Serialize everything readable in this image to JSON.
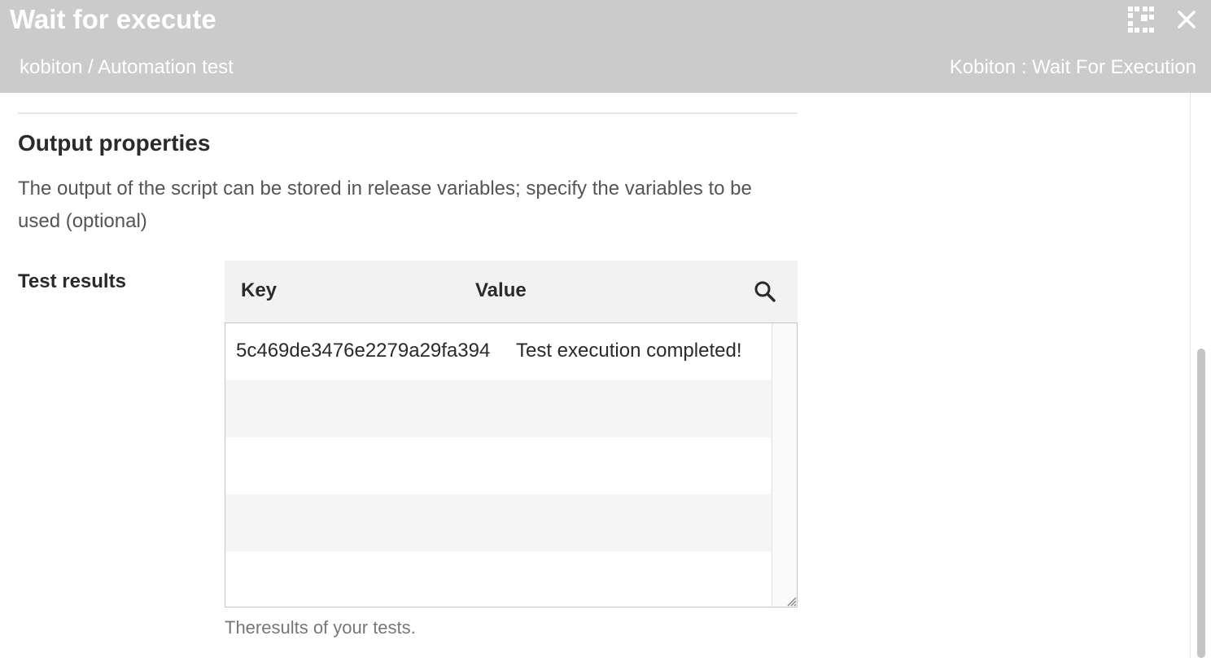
{
  "header": {
    "title": "Wait for execute",
    "breadcrumb": "kobiton / Automation test",
    "task_type": "Kobiton : Wait For Execution",
    "icons": [
      "fullscreen-exit-icon",
      "close-icon"
    ]
  },
  "output_section": {
    "title": "Output properties",
    "description": "The output of the script can be stored in release variables; specify the variables to be used (optional)"
  },
  "test_results": {
    "label": "Test results",
    "columns": {
      "key": "Key",
      "value": "Value"
    },
    "rows": [
      {
        "key": "5c469de3476e2279a29fa394",
        "value": "Test execution completed!"
      }
    ],
    "help_text": "Theresults of your tests."
  },
  "colors": {
    "header_bg": "#cbcbcb",
    "header_text": "#ffffff",
    "table_header_bg": "#f2f2f2",
    "row_alt_bg": "#f5f5f5"
  }
}
